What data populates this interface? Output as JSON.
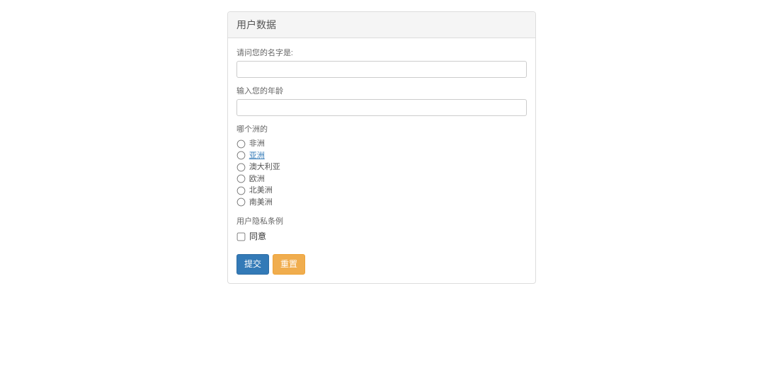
{
  "panel": {
    "title": "用户数据"
  },
  "form": {
    "name_label": "请问您的名字是:",
    "age_label": "输入您的年龄",
    "continent_label": "哪个洲的",
    "continents": [
      "非洲",
      "亚洲",
      "澳大利亚",
      "欧洲",
      "北美洲",
      "南美洲"
    ],
    "privacy_label": "用户隐私条例",
    "agree_label": "同意",
    "submit_label": "提交",
    "reset_label": "重置"
  }
}
